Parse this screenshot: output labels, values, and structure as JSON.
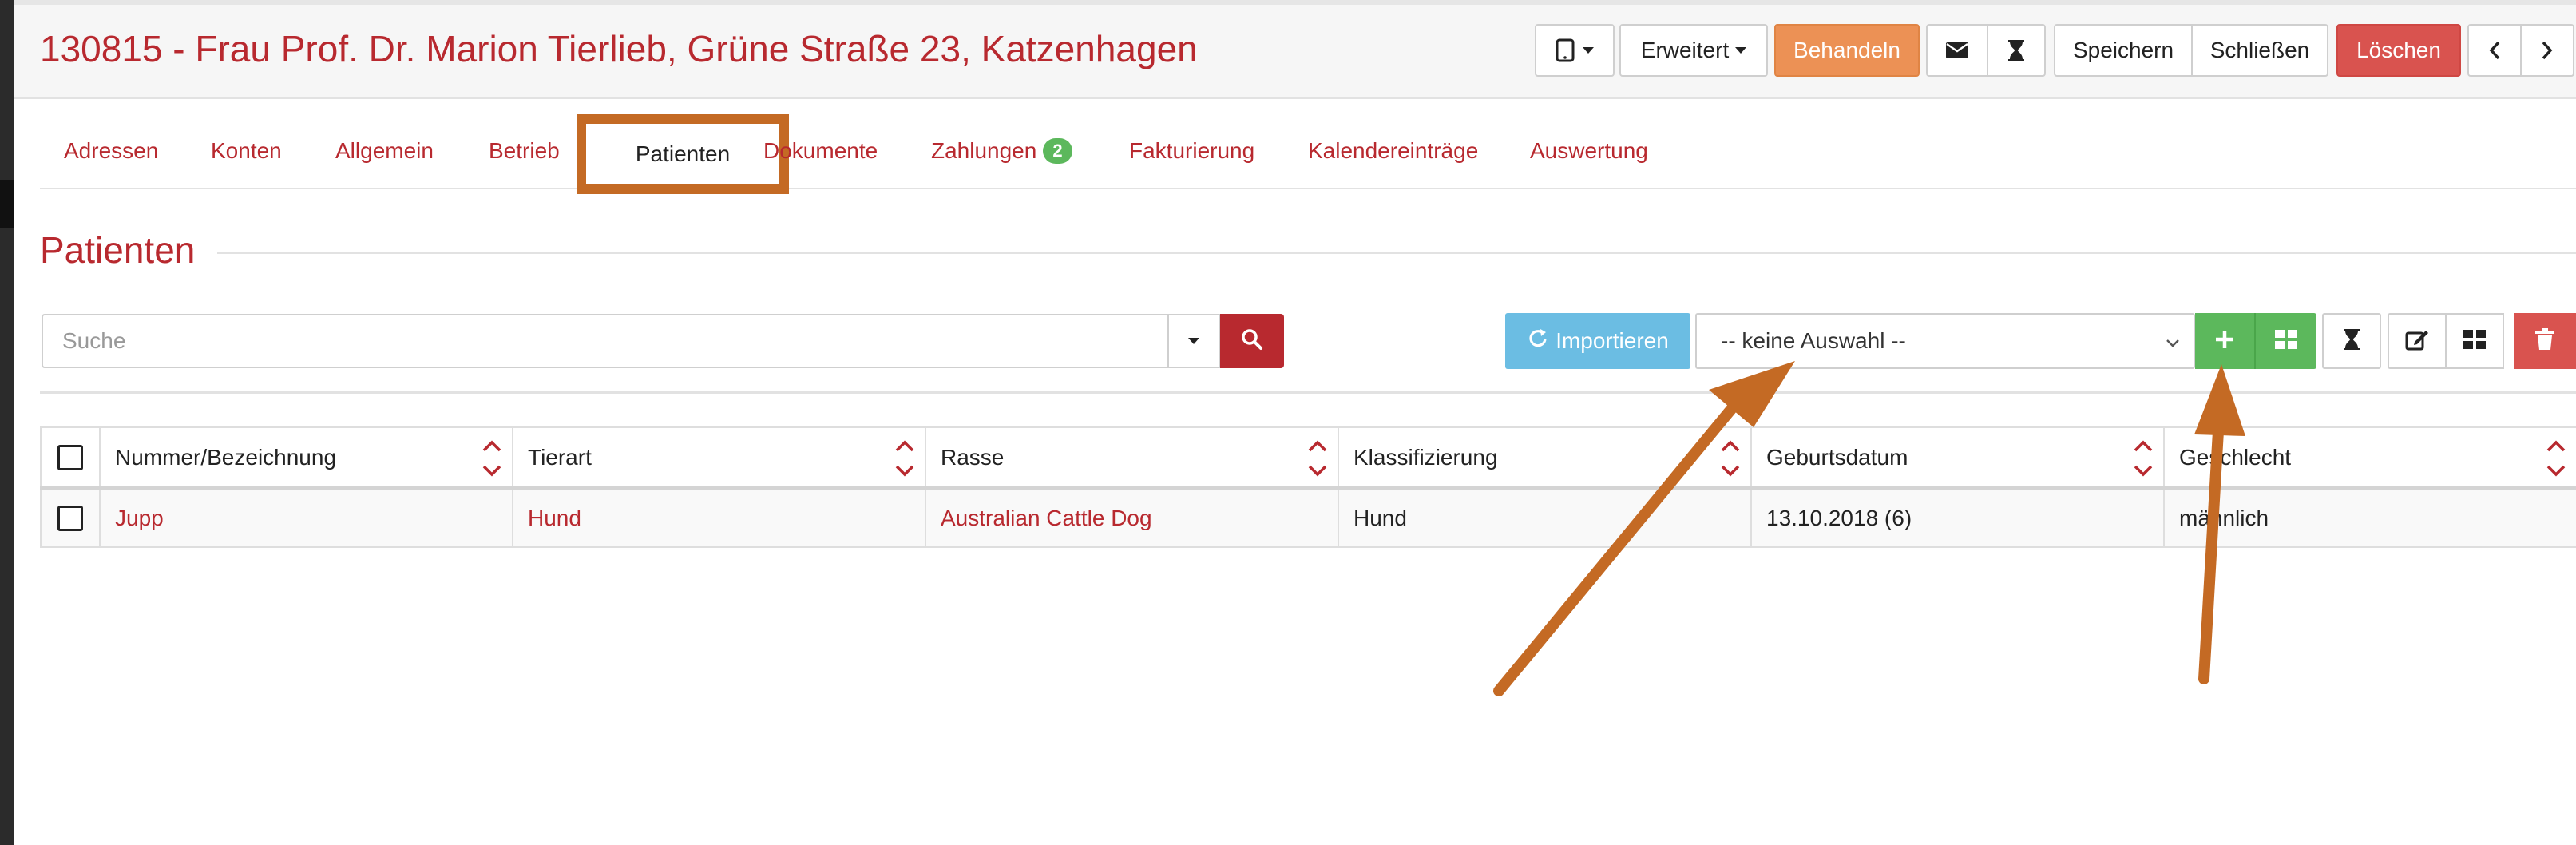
{
  "header": {
    "title": "130815 - Frau Prof. Dr. Marion Tierlieb, Grüne Straße 23, Katzenhagen",
    "buttons": {
      "extended": "Erweitert",
      "treat": "Behandeln",
      "save": "Speichern",
      "close": "Schließen",
      "delete": "Löschen"
    }
  },
  "tabs": [
    {
      "label": "Adressen"
    },
    {
      "label": "Konten"
    },
    {
      "label": "Allgemein"
    },
    {
      "label": "Betrieb"
    },
    {
      "label": "Patienten",
      "active": true
    },
    {
      "label": "Dokumente"
    },
    {
      "label": "Zahlungen",
      "badge": "2"
    },
    {
      "label": "Fakturierung"
    },
    {
      "label": "Kalendereinträge"
    },
    {
      "label": "Auswertung"
    }
  ],
  "section": {
    "title": "Patienten"
  },
  "toolbar": {
    "search_placeholder": "Suche",
    "import_label": "Importieren",
    "select_value": "-- keine Auswahl --"
  },
  "table": {
    "columns": [
      "Nummer/Bezeichnung",
      "Tierart",
      "Rasse",
      "Klassifizierung",
      "Geburtsdatum",
      "Geschlecht"
    ],
    "rows": [
      [
        "Jupp",
        "Hund",
        "Australian Cattle Dog",
        "Hund",
        "13.10.2018 (6)",
        "männlich"
      ]
    ]
  },
  "colors": {
    "accent": "#b8292f",
    "treat": "#ec9155",
    "delete": "#d9534f",
    "success": "#5cb85c",
    "info": "#6bbde3",
    "annotation": "#c46a24"
  }
}
